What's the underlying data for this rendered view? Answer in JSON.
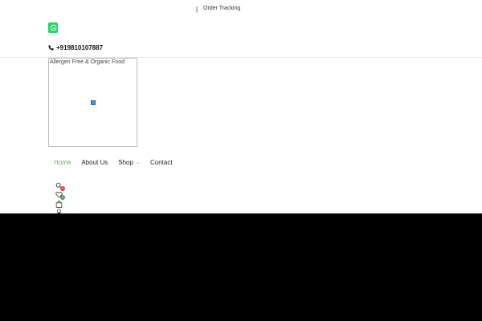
{
  "topbar": {
    "separator": "|",
    "order_tracking": "Order Tracking"
  },
  "contact": {
    "phone": "+919810107887"
  },
  "logo": {
    "alt_text": "Allergen Free & Organic Food"
  },
  "nav": {
    "items": [
      {
        "label": "Home",
        "active": true
      },
      {
        "label": "About Us"
      },
      {
        "label": "Shop",
        "has_dropdown": true
      },
      {
        "label": "Contact"
      }
    ]
  },
  "header_icons": {
    "wishlist_count": "0",
    "cart_count": "0"
  },
  "colors": {
    "accent": "#5cb85c",
    "whatsapp": "#25d366",
    "wishlist_badge": "#e53935",
    "cart_badge": "#43a047"
  }
}
